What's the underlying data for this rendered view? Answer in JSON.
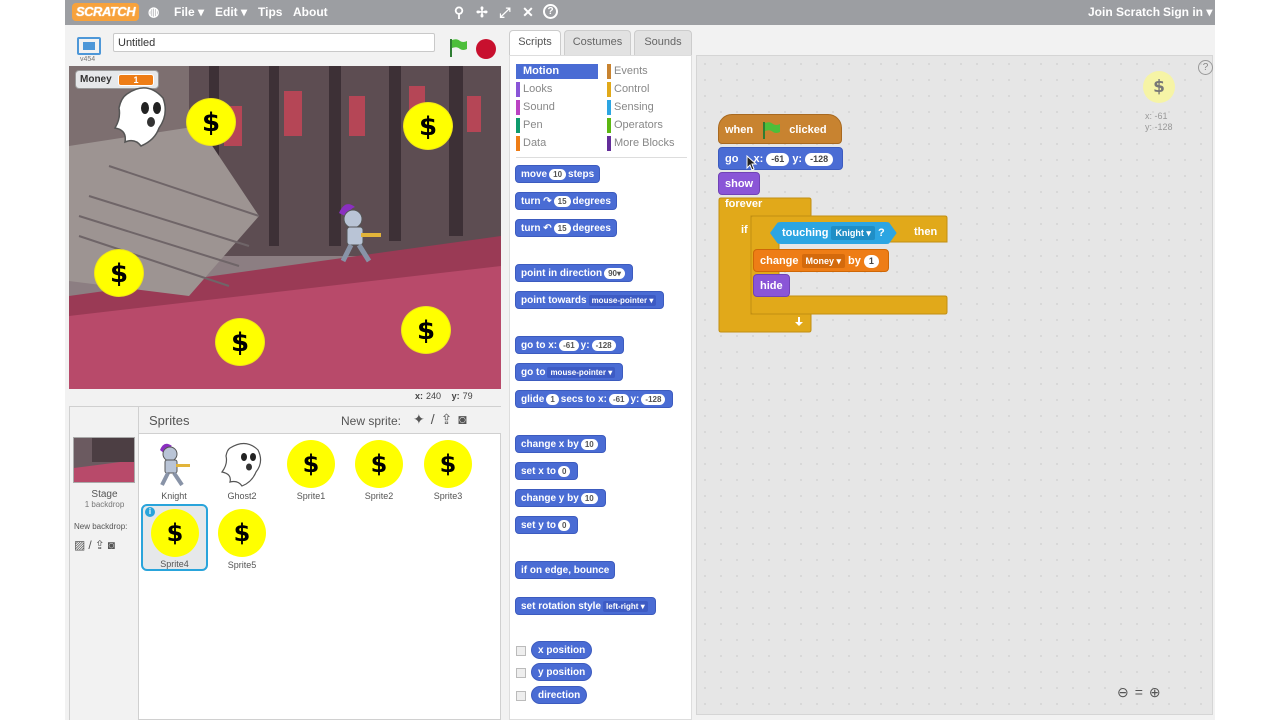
{
  "topbar": {
    "logo": "SCRATCH",
    "menu": [
      "File",
      "Edit",
      "Tips",
      "About"
    ],
    "file_label": "File ▾",
    "edit_label": "Edit ▾",
    "tips_label": "Tips",
    "about_label": "About",
    "join_label": "Join Scratch",
    "signin_label": "Sign in ▾"
  },
  "stage_header": {
    "version": "v454",
    "project_title": "Untitled"
  },
  "stage": {
    "monitor_label": "Money",
    "monitor_value": "1",
    "coin_symbol": "$",
    "mouse_x_label": "x:",
    "mouse_x": "240",
    "mouse_y_label": "y:",
    "mouse_y": "79"
  },
  "sprites_pane": {
    "title": "Sprites",
    "new_sprite_label": "New sprite:",
    "stage_label": "Stage",
    "stage_sub": "1 backdrop",
    "new_backdrop_label": "New backdrop:",
    "sprites": [
      "Knight",
      "Ghost2",
      "Sprite1",
      "Sprite2",
      "Sprite3",
      "Sprite4",
      "Sprite5"
    ],
    "selected": "Sprite4"
  },
  "tabs": {
    "scripts": "Scripts",
    "costumes": "Costumes",
    "sounds": "Sounds"
  },
  "categories": {
    "motion": "Motion",
    "looks": "Looks",
    "sound": "Sound",
    "pen": "Pen",
    "data": "Data",
    "events": "Events",
    "control": "Control",
    "sensing": "Sensing",
    "operators": "Operators",
    "more": "More Blocks"
  },
  "palette": {
    "move": "move",
    "move_val": "10",
    "steps": "steps",
    "turn": "turn",
    "turn_val": "15",
    "degrees": "degrees",
    "point_dir": "point in direction",
    "point_dir_val": "90▾",
    "point_towards": "point towards",
    "point_towards_val": "mouse-pointer ▾",
    "goto": "go to x:",
    "goto_x": "-61",
    "y_label": "y:",
    "goto_y": "-128",
    "goto2": "go to",
    "goto2_val": "mouse-pointer ▾",
    "glide": "glide",
    "glide_val": "1",
    "glide_secs": "secs to x:",
    "glide_x": "-61",
    "glide_y": "-128",
    "change_x": "change x by",
    "change_x_val": "10",
    "set_x": "set x to",
    "set_x_val": "0",
    "change_y": "change y by",
    "change_y_val": "10",
    "set_y": "set y to",
    "set_y_val": "0",
    "bounce": "if on edge, bounce",
    "rot_style": "set rotation style",
    "rot_style_val": "left-right ▾",
    "xpos": "x position",
    "ypos": "y position",
    "direction": "direction"
  },
  "script": {
    "when": "when",
    "clicked": "clicked",
    "go": "go",
    "x_label": "x:",
    "x_val": "-61",
    "y_label": "y:",
    "y_val": "-128",
    "show": "show",
    "forever": "forever",
    "if": "if",
    "touching": "touching",
    "touching_val": "Knight ▾",
    "q": "?",
    "then": "then",
    "change": "change",
    "change_var": "Money ▾",
    "by": "by",
    "by_val": "1",
    "hide": "hide"
  },
  "script_area": {
    "sprite_x": "x: -61",
    "sprite_y": "y: -128",
    "coin_symbol": "$"
  },
  "colors": {
    "motion": "#4a6cd4",
    "looks": "#8a55d7",
    "sound": "#bb42c3",
    "pen": "#0e9a6c",
    "data": "#ee7d16",
    "events": "#c88330",
    "control": "#e1a91a",
    "sensing": "#2ca5e2",
    "operators": "#5cb712",
    "more": "#632d99"
  }
}
